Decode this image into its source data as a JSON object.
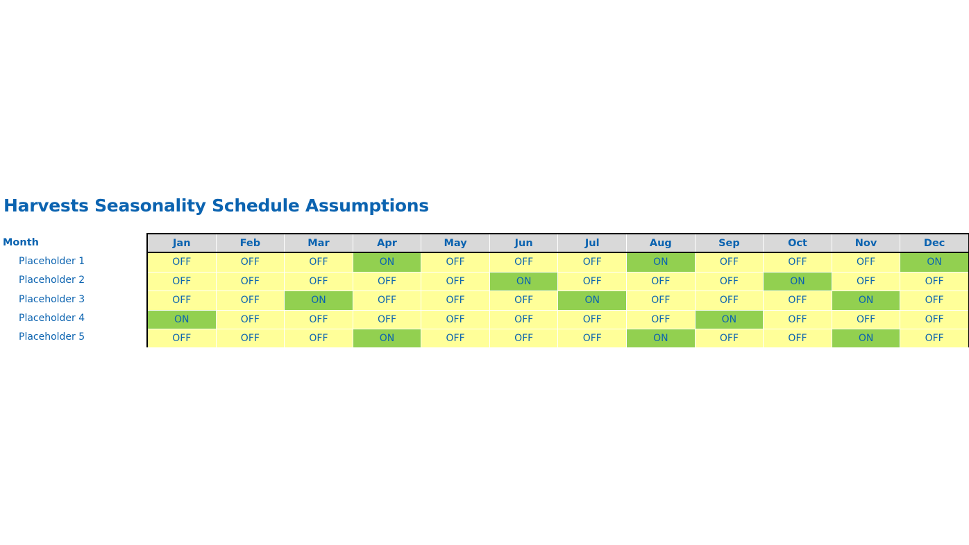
{
  "title": "Harvests Seasonality Schedule Assumptions",
  "month_label": "Month",
  "colors": {
    "on": "#92d050",
    "off": "#ffff99",
    "header": "#d9d9d9",
    "text": "#0b63b0"
  },
  "months": [
    "Jan",
    "Feb",
    "Mar",
    "Apr",
    "May",
    "Jun",
    "Jul",
    "Aug",
    "Sep",
    "Oct",
    "Nov",
    "Dec"
  ],
  "rows": [
    {
      "label": "Placeholder 1",
      "values": [
        "OFF",
        "OFF",
        "OFF",
        "ON",
        "OFF",
        "OFF",
        "OFF",
        "ON",
        "OFF",
        "OFF",
        "OFF",
        "ON"
      ]
    },
    {
      "label": "Placeholder 2",
      "values": [
        "OFF",
        "OFF",
        "OFF",
        "OFF",
        "OFF",
        "ON",
        "OFF",
        "OFF",
        "OFF",
        "ON",
        "OFF",
        "OFF"
      ]
    },
    {
      "label": "Placeholder 3",
      "values": [
        "OFF",
        "OFF",
        "ON",
        "OFF",
        "OFF",
        "OFF",
        "ON",
        "OFF",
        "OFF",
        "OFF",
        "ON",
        "OFF"
      ]
    },
    {
      "label": "Placeholder 4",
      "values": [
        "ON",
        "OFF",
        "OFF",
        "OFF",
        "OFF",
        "OFF",
        "OFF",
        "OFF",
        "ON",
        "OFF",
        "OFF",
        "OFF"
      ]
    },
    {
      "label": "Placeholder 5",
      "values": [
        "OFF",
        "OFF",
        "OFF",
        "ON",
        "OFF",
        "OFF",
        "OFF",
        "ON",
        "OFF",
        "OFF",
        "ON",
        "OFF"
      ]
    }
  ]
}
